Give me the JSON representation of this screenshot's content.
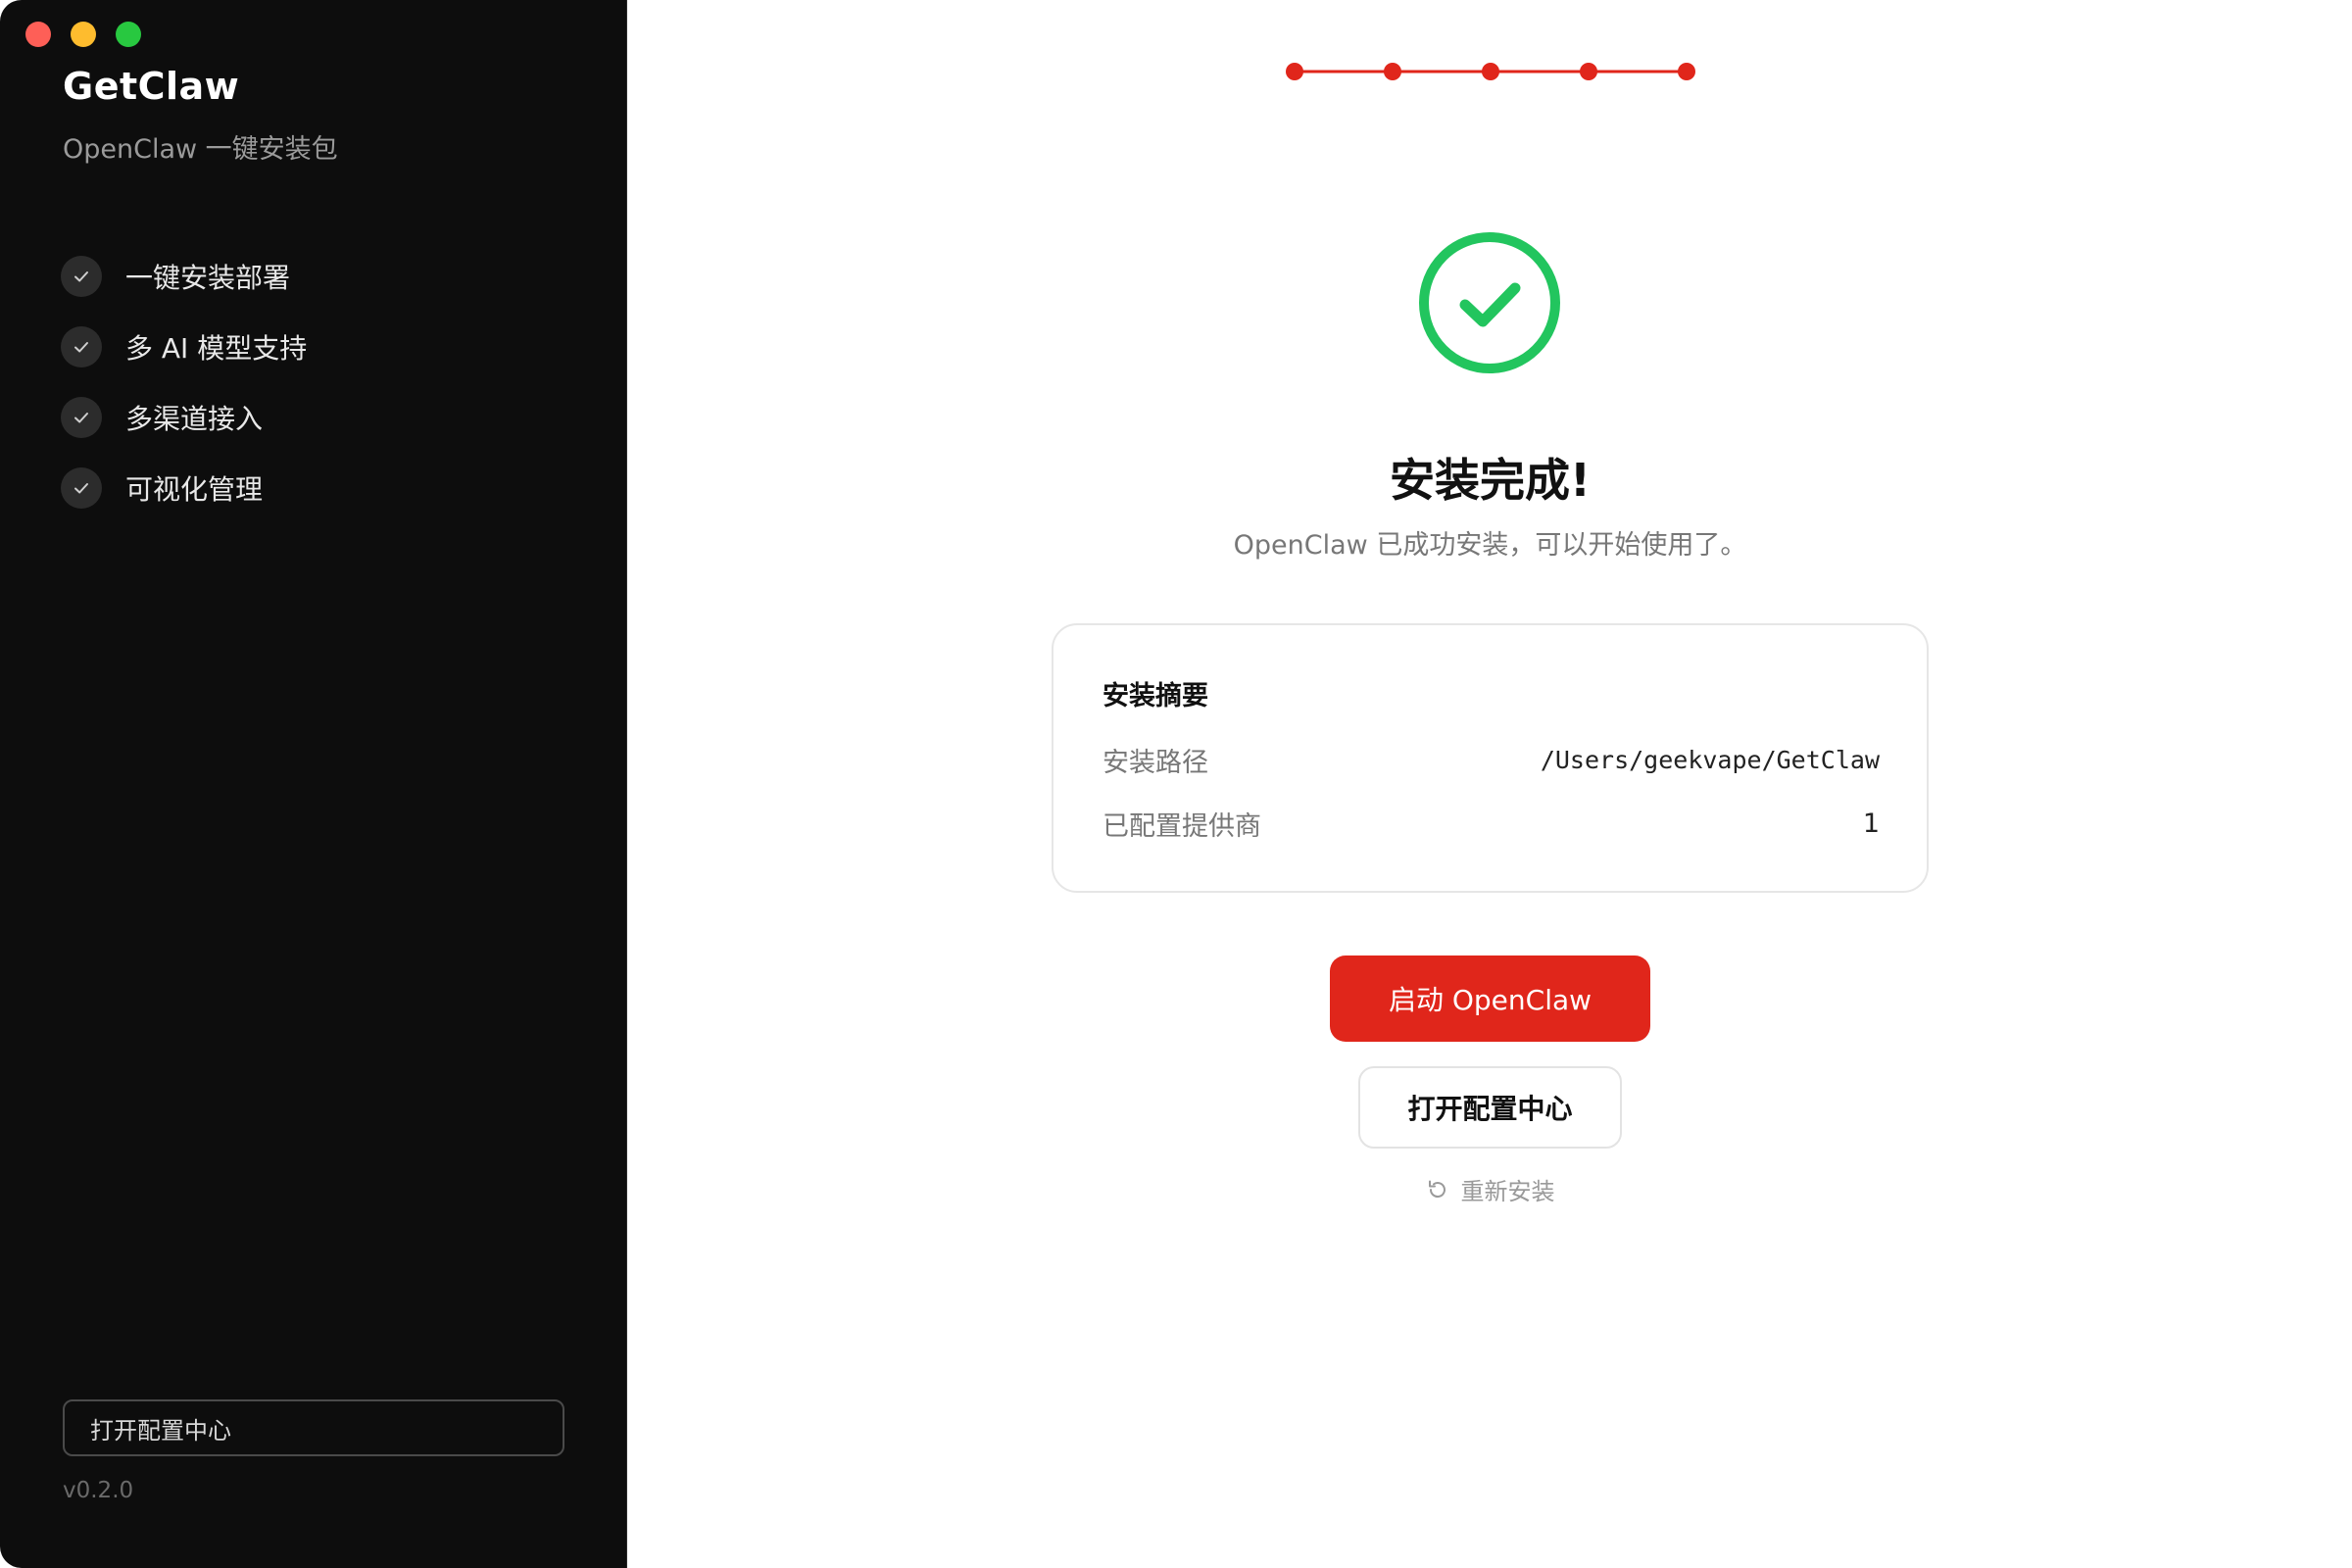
{
  "sidebar": {
    "title": "GetClaw",
    "subtitle": "OpenClaw 一键安装包",
    "features": [
      {
        "label": "一键安装部署"
      },
      {
        "label": "多 AI 模型支持"
      },
      {
        "label": "多渠道接入"
      },
      {
        "label": "可视化管理"
      }
    ],
    "config_button": "打开配置中心",
    "version": "v0.2.0"
  },
  "stepper": {
    "total_steps": 5,
    "completed_steps": 5,
    "color": "#e0261b"
  },
  "main": {
    "status_icon": "check-circle-icon",
    "status_color": "#22c55e",
    "title": "安装完成!",
    "subtitle": "OpenClaw 已成功安装，可以开始使用了。",
    "summary": {
      "heading": "安装摘要",
      "install_path_label": "安装路径",
      "install_path_value": "/Users/geekvape/GetClaw",
      "providers_label": "已配置提供商",
      "providers_value": "1"
    },
    "launch_button": "启动 OpenClaw",
    "open_config_button": "打开配置中心",
    "reinstall_link": "重新安装"
  },
  "colors": {
    "accent": "#e0261b",
    "success": "#22c55e",
    "sidebar_bg": "#0d0d0d"
  }
}
